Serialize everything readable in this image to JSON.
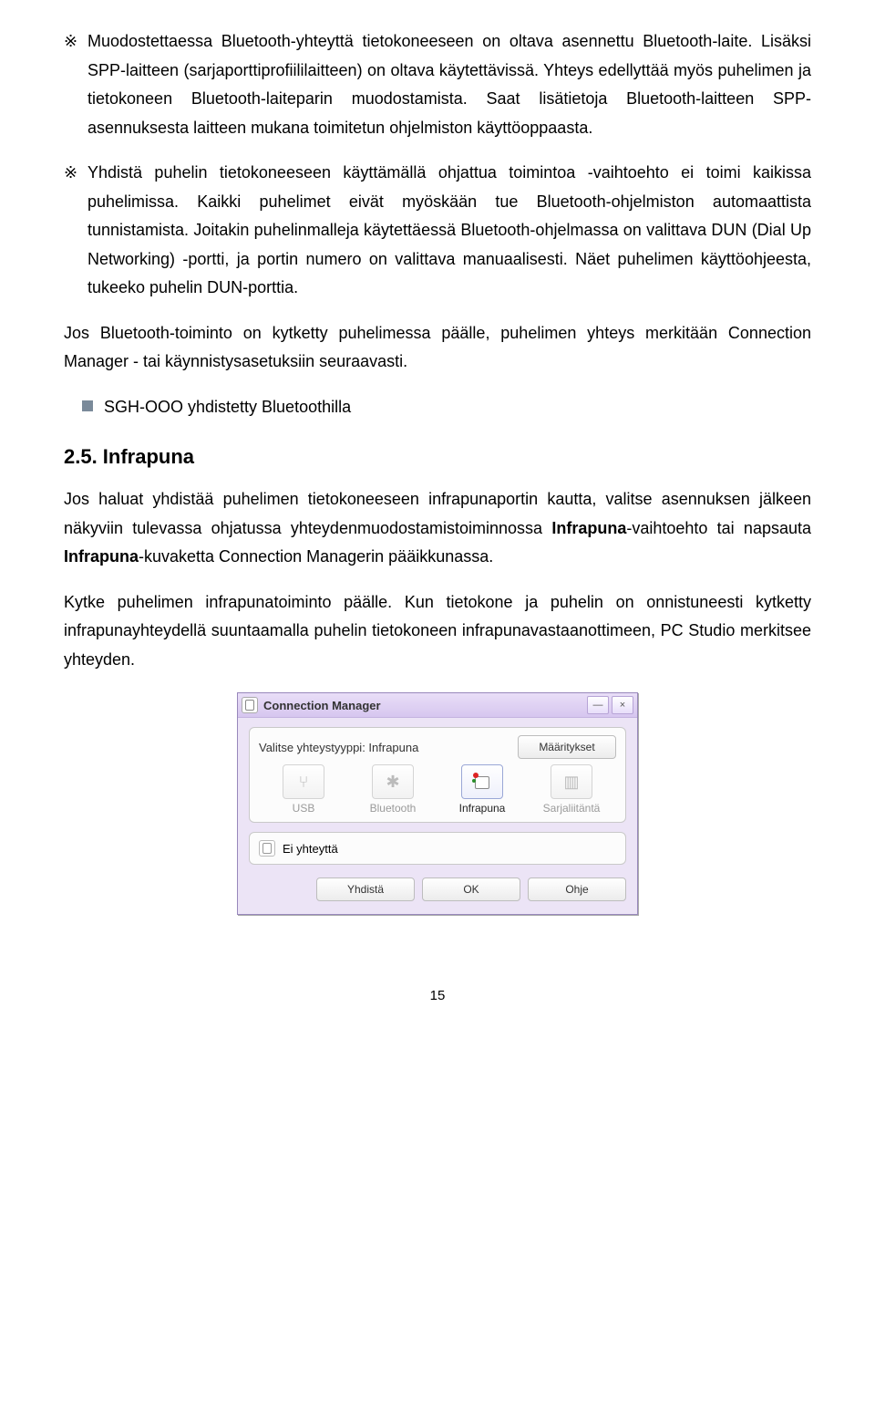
{
  "paragraphs": {
    "p1": "Muodostettaessa Bluetooth-yhteyttä tietokoneeseen on oltava asennettu Bluetooth-laite. Lisäksi SPP-laitteen (sarjaporttiprofiililaitteen) on oltava käytettävissä. Yhteys edellyttää myös puhelimen ja tietokoneen Bluetooth-laiteparin muodostamista. Saat lisätietoja Bluetooth-laitteen SPP-asennuksesta laitteen mukana toimitetun ohjelmiston käyttöoppaasta.",
    "p2": "Yhdistä puhelin tietokoneeseen käyttämällä ohjattua toimintoa -vaihtoehto ei toimi kaikissa puhelimissa. Kaikki puhelimet eivät myöskään tue Bluetooth-ohjelmiston automaattista tunnistamista. Joitakin puhelinmalleja käytettäessä Bluetooth-ohjelmassa on valittava DUN (Dial Up Networking) -portti, ja portin numero on valittava manuaalisesti. Näet puhelimen käyttöohjeesta, tukeeko puhelin DUN-porttia.",
    "p3": "Jos Bluetooth-toiminto on kytketty puhelimessa päälle, puhelimen yhteys merkitään Connection Manager - tai käynnistysasetuksiin seuraavasti.",
    "p4": "SGH-OOO yhdistetty Bluetoothilla",
    "p5_a": "Jos haluat yhdistää puhelimen tietokoneeseen infrapunaportin kautta, valitse asennuksen jälkeen näkyviin tulevassa ohjatussa yhteydenmuodostamistoiminnossa ",
    "p5_bold1": "Infrapuna",
    "p5_b": "-vaihtoehto tai napsauta ",
    "p5_bold2": "Infrapuna",
    "p5_c": "-kuvaketta Connection Managerin pääikkunassa.",
    "p6": "Kytke puhelimen infrapunatoiminto päälle. Kun tietokone ja puhelin on onnistuneesti kytketty infrapunayhteydellä suuntaamalla puhelin tietokoneen infrapunavastaanottimeen, PC Studio merkitsee yhteyden."
  },
  "heading": "2.5. Infrapuna",
  "bullet": "※",
  "dialog": {
    "title": "Connection Manager",
    "minimize": "—",
    "close": "×",
    "conn_label": "Valitse yhteystyyppi: Infrapuna",
    "settings_btn": "Määritykset",
    "types": {
      "usb": "USB",
      "bluetooth": "Bluetooth",
      "infrared": "Infrapuna",
      "serial": "Sarjaliitäntä"
    },
    "status": "Ei yhteyttä",
    "buttons": {
      "connect": "Yhdistä",
      "ok": "OK",
      "help": "Ohje"
    }
  },
  "page_number": "15"
}
